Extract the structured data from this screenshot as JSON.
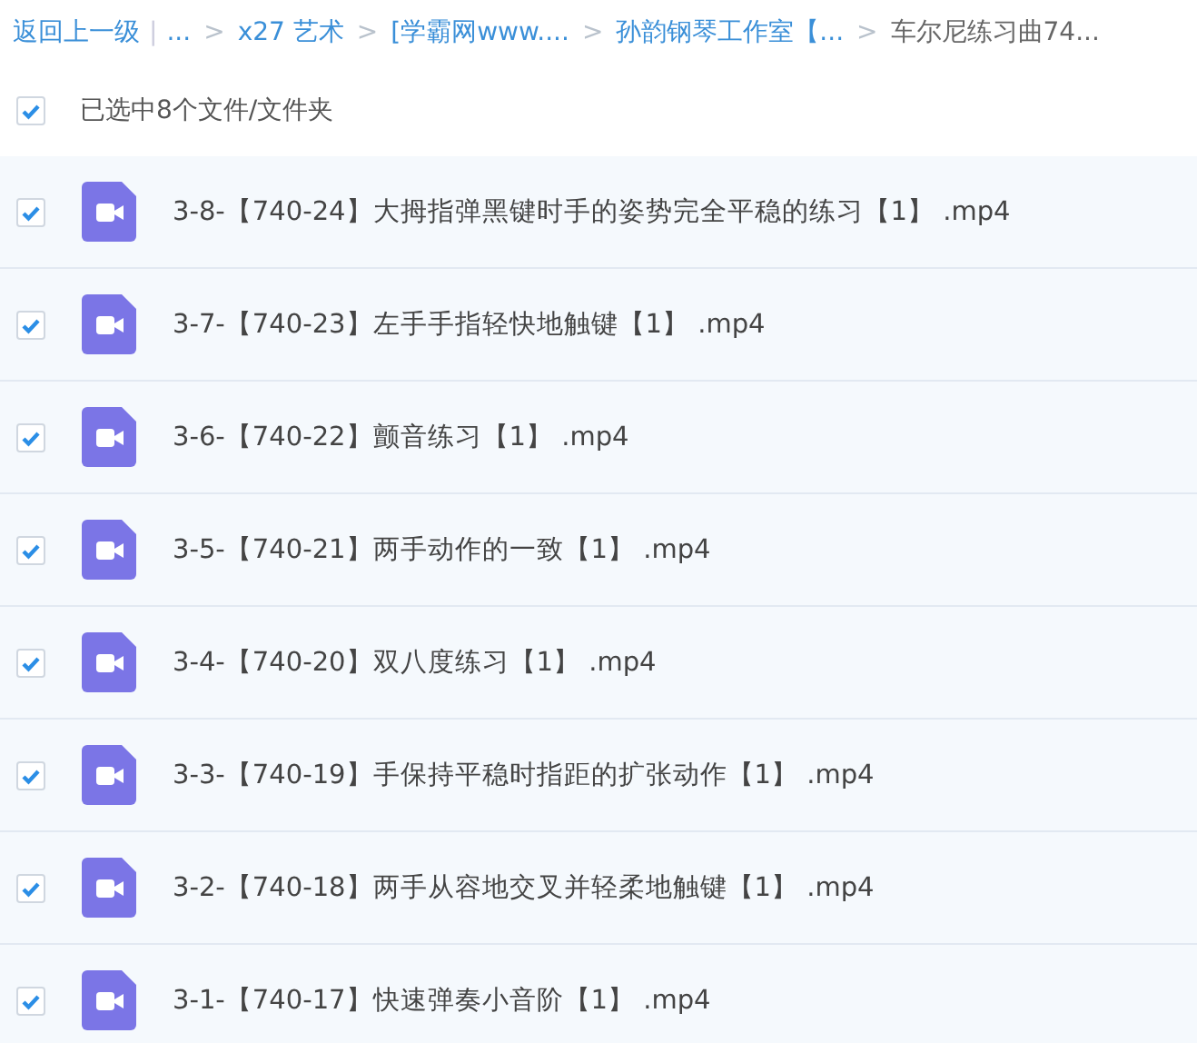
{
  "breadcrumb": {
    "back": "返回上一级",
    "divider": "|",
    "separator": ">",
    "items": [
      {
        "label": "...",
        "link": true
      },
      {
        "label": "x27 艺术",
        "link": true
      },
      {
        "label": "[学霸网www....",
        "link": true
      },
      {
        "label": "孙韵钢琴工作室【...",
        "link": true
      },
      {
        "label": "车尔尼练习曲74...",
        "link": false
      }
    ]
  },
  "selection": {
    "checked": true,
    "label": "已选中8个文件/文件夹"
  },
  "files": [
    {
      "name": "3-8-【740-24】大拇指弹黑键时手的姿势完全平稳的练习【1】 .mp4",
      "checked": true
    },
    {
      "name": "3-7-【740-23】左手手指轻快地触键【1】 .mp4",
      "checked": true
    },
    {
      "name": "3-6-【740-22】颤音练习【1】 .mp4",
      "checked": true
    },
    {
      "name": "3-5-【740-21】两手动作的一致【1】 .mp4",
      "checked": true
    },
    {
      "name": "3-4-【740-20】双八度练习【1】 .mp4",
      "checked": true
    },
    {
      "name": "3-3-【740-19】手保持平稳时指距的扩张动作【1】 .mp4",
      "checked": true
    },
    {
      "name": "3-2-【740-18】两手从容地交叉并轻柔地触键【1】 .mp4",
      "checked": true
    },
    {
      "name": "3-1-【740-17】快速弹奏小音阶【1】 .mp4",
      "checked": true
    }
  ]
}
